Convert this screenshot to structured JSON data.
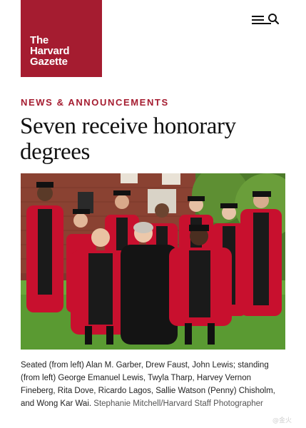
{
  "brand": {
    "logo_lines": [
      "The",
      "Harvard",
      "Gazette"
    ],
    "color": "#a51c30"
  },
  "header": {
    "menu_icon": "hamburger-search-icon"
  },
  "article": {
    "section": "NEWS & ANNOUNCEMENTS",
    "headline": "Seven receive honorary degrees",
    "photo": {
      "subject": "honorary degree recipients in crimson academic robes posed on a lawn"
    },
    "caption": "Seated (from left) Alan M. Garber, Drew Faust, John Lewis; standing (from left) George Emanuel Lewis, Twyla Tharp, Harvey Vernon Fineberg, Rita Dove, Ricardo Lagos, Sallie Watson (Penny) Chisholm, and Wong Kar Wai.",
    "credit": "Stephanie Mitchell/Harvard Staff Photographer"
  },
  "watermark": "@金火"
}
